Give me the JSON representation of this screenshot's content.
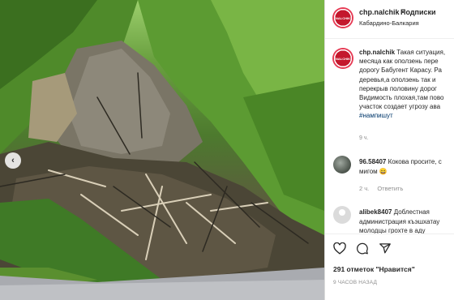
{
  "post": {
    "username": "chp.nalchik",
    "separator": "•",
    "follow_label": "Подписки",
    "location": "Кабардино-Балкария",
    "avatar_text": "NALCHIK"
  },
  "caption": {
    "username": "chp.nalchik",
    "lines": [
      " Такая ситуация,",
      "месяца как оползень пере",
      "дорогу Бабугент Карасу. Ра",
      "деревья,а оползень так и",
      "перекрыв половину дорог",
      "Видимость плохая,там пово",
      "участок создает угрозу ава"
    ],
    "hashtag": "#нампишут",
    "time": "9 ч."
  },
  "comments": [
    {
      "username": "96.58407",
      "lines": [
        " Кокова просите, с",
        "мигом 😄"
      ],
      "time": "2 ч.",
      "reply_label": "Ответить"
    },
    {
      "username": "alibek8407",
      "lines": [
        " Доблестная",
        "администрация къэшхатау",
        "молодцы грохте в аду"
      ]
    }
  ],
  "footer": {
    "likes": "291 отметок \"Нравится\"",
    "ago": "9 ЧАСОВ НАЗАД"
  },
  "icons": {
    "like": "heart-icon",
    "comment": "comment-icon",
    "share": "share-icon",
    "prev": "chevron-left-icon"
  },
  "colors": {
    "link": "#00376b",
    "muted": "#8e8e8e",
    "text": "#262626",
    "avatar_red": "#c4182d"
  }
}
